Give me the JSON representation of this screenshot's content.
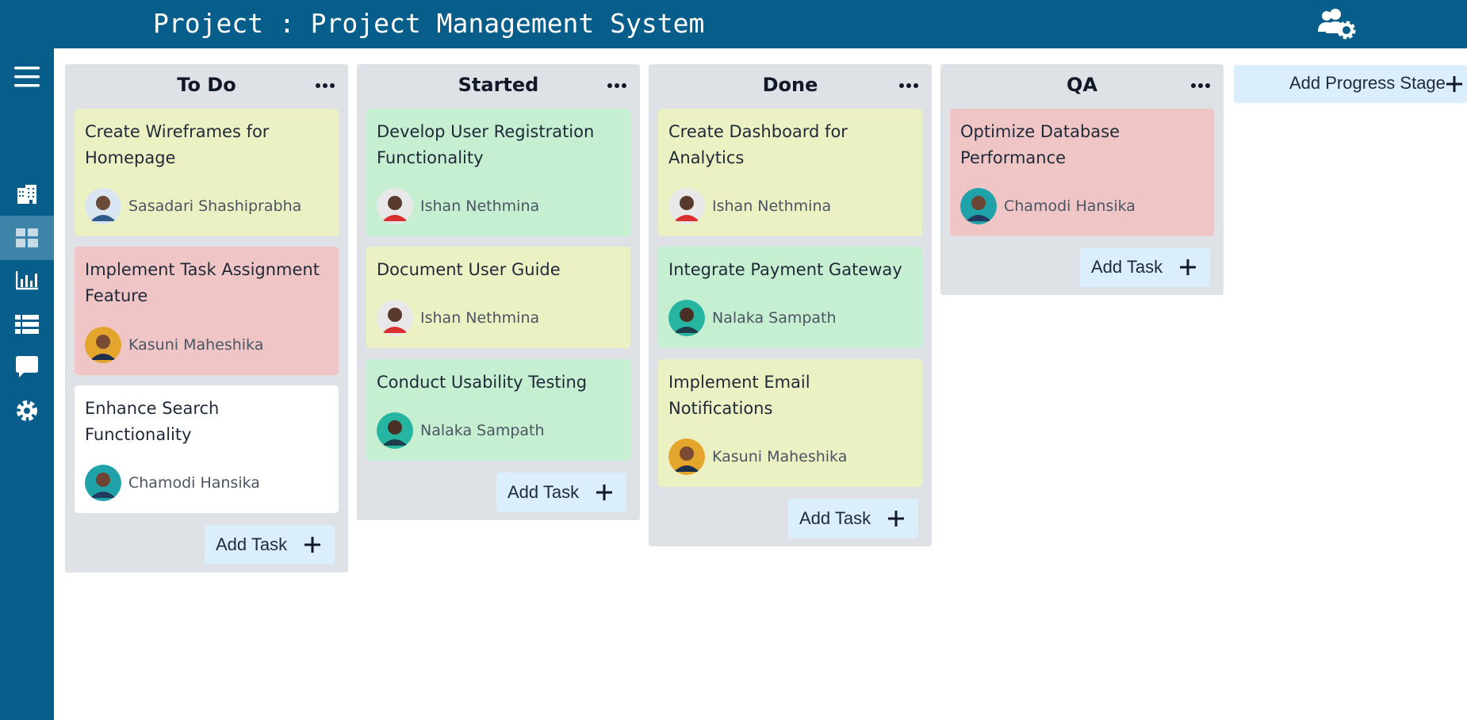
{
  "header": {
    "title": "Project : Project Management System",
    "settings_icon": "users-gear-icon"
  },
  "sidebar": {
    "items": [
      {
        "name": "menu",
        "icon": "hamburger-icon",
        "active": false
      },
      {
        "name": "projects",
        "icon": "building-icon",
        "active": false
      },
      {
        "name": "board",
        "icon": "grid-icon",
        "active": true
      },
      {
        "name": "reports",
        "icon": "bar-chart-icon",
        "active": false
      },
      {
        "name": "list",
        "icon": "list-icon",
        "active": false
      },
      {
        "name": "chat",
        "icon": "chat-icon",
        "active": false
      },
      {
        "name": "settings",
        "icon": "gear-icon",
        "active": false
      }
    ]
  },
  "colors": {
    "header_bg": "#075e8a",
    "sidebar_active": "#3e84a8",
    "column_bg": "#dee2e6",
    "card_yellow": "#ecf1c4",
    "card_green": "#c6efd2",
    "card_red": "#f0c5c6",
    "card_white": "#ffffff",
    "button_bg": "#dbeefb"
  },
  "board": {
    "columns": [
      {
        "title": "To Do",
        "add_task_label": "Add Task",
        "cards": [
          {
            "title": "Create Wireframes for Homepage",
            "assignee": "Sasadari Shashiprabha",
            "color": "yellow"
          },
          {
            "title": "Implement Task Assignment Feature",
            "assignee": "Kasuni Maheshika",
            "color": "red"
          },
          {
            "title": "Enhance Search Functionality",
            "assignee": "Chamodi Hansika",
            "color": "white"
          }
        ]
      },
      {
        "title": "Started",
        "add_task_label": "Add Task",
        "cards": [
          {
            "title": "Develop User Registration Functionality",
            "assignee": "Ishan Nethmina",
            "color": "green"
          },
          {
            "title": "Document User Guide",
            "assignee": "Ishan Nethmina",
            "color": "yellow"
          },
          {
            "title": "Conduct Usability Testing",
            "assignee": "Nalaka Sampath",
            "color": "green"
          }
        ]
      },
      {
        "title": "Done",
        "add_task_label": "Add Task",
        "cards": [
          {
            "title": "Create Dashboard for Analytics",
            "assignee": "Ishan Nethmina",
            "color": "yellow"
          },
          {
            "title": "Integrate Payment Gateway",
            "assignee": "Nalaka Sampath",
            "color": "green"
          },
          {
            "title": "Implement Email Notifications",
            "assignee": "Kasuni Maheshika",
            "color": "yellow"
          }
        ]
      },
      {
        "title": "QA",
        "add_task_label": "Add Task",
        "cards": [
          {
            "title": "Optimize Database Performance",
            "assignee": "Chamodi Hansika",
            "color": "red"
          }
        ]
      }
    ],
    "add_stage_label": "Add Progress Stage"
  }
}
